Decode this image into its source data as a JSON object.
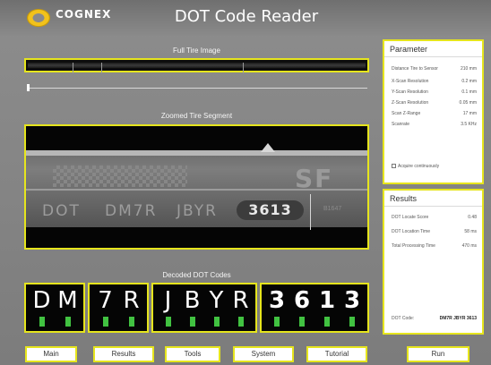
{
  "header": {
    "logo_name": "COGNEX",
    "logo_sub": "",
    "title": "DOT Code Reader"
  },
  "left": {
    "full_image_title": "Full Tire Image",
    "zoomed_title": "Zoomed Tire Segment",
    "decoded_title": "Decoded DOT Codes"
  },
  "zoom_image": {
    "text_dot": "DOT",
    "text_dm7r": "DM7R",
    "text_jbyr": "JBYR",
    "text_code": "3613",
    "text_tail": "B1647",
    "text_big": "SF"
  },
  "decoded": {
    "groups": [
      {
        "chars": [
          "D",
          "M"
        ]
      },
      {
        "chars": [
          "7",
          "R"
        ]
      },
      {
        "chars": [
          "J",
          "B",
          "Y",
          "R"
        ]
      },
      {
        "chars": [
          "3",
          "6",
          "1",
          "3"
        ]
      }
    ]
  },
  "parameters": {
    "title": "Parameter",
    "rows": [
      {
        "label": "Distance Tire to Sensor",
        "value": "210 mm"
      },
      {
        "label": "X-Scan Resolution",
        "value": "0.2 mm"
      },
      {
        "label": "Y-Scan Resolution",
        "value": "0.1 mm"
      },
      {
        "label": "Z-Scan Resolution",
        "value": "0.05 mm"
      },
      {
        "label": "Scan Z-Range",
        "value": "17 mm"
      },
      {
        "label": "Scanrate",
        "value": "3.5 KHz"
      }
    ],
    "acquire_label": "Acquire continuously"
  },
  "results": {
    "title": "Results",
    "rows": [
      {
        "label": "DOT Locate Score",
        "value": "0.48"
      },
      {
        "label": "DOT Location Time",
        "value": "58 ms"
      },
      {
        "label": "Total Processing Time",
        "value": "470 ms"
      }
    ],
    "dot_code_label": "DOT Code:",
    "dot_code_value": "DM7R JBYR 3613"
  },
  "buttons": {
    "main": "Main",
    "results": "Results",
    "tools": "Tools",
    "system": "System",
    "tutorial": "Tutorial",
    "run": "Run"
  },
  "colors": {
    "accent": "#e6e51d",
    "bar_green": "#41c241",
    "background": "#8a8a8a"
  }
}
